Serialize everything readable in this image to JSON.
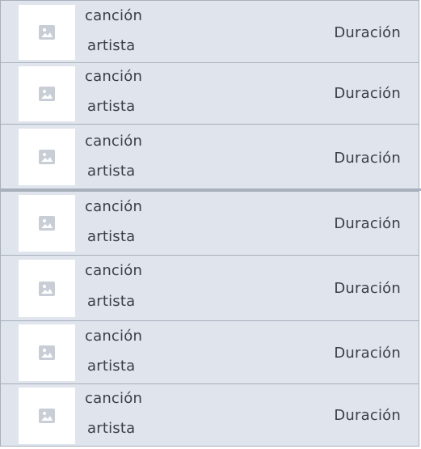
{
  "songs": [
    {
      "title": "canción",
      "artist": "artista",
      "duration": "Duración",
      "thumbnail_icon": "image-placeholder-icon"
    },
    {
      "title": "canción",
      "artist": "artista",
      "duration": "Duración",
      "thumbnail_icon": "image-placeholder-icon"
    },
    {
      "title": "canción",
      "artist": "artista",
      "duration": "Duración",
      "thumbnail_icon": "image-placeholder-icon"
    },
    {
      "title": "canción",
      "artist": "artista",
      "duration": "Duración",
      "thumbnail_icon": "image-placeholder-icon"
    },
    {
      "title": "canción",
      "artist": "artista",
      "duration": "Duración",
      "thumbnail_icon": "image-placeholder-icon"
    },
    {
      "title": "canción",
      "artist": "artista",
      "duration": "Duración",
      "thumbnail_icon": "image-placeholder-icon"
    },
    {
      "title": "canción",
      "artist": "artista",
      "duration": "Duración",
      "thumbnail_icon": "image-placeholder-icon"
    }
  ],
  "colors": {
    "row_background": "#dfe4ed",
    "row_border": "#a8b0bb",
    "thumbnail_background": "#ffffff",
    "icon_color": "#c9ced6",
    "text_color": "#3a3f47"
  }
}
